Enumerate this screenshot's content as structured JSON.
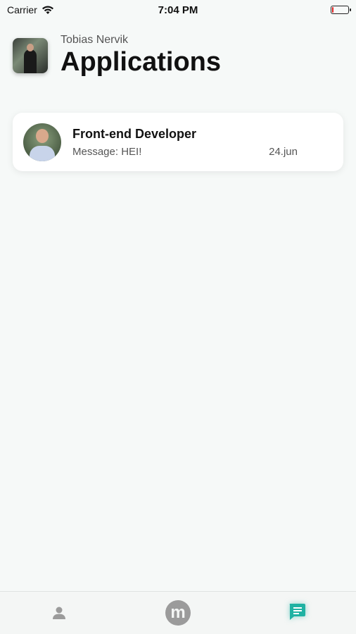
{
  "status_bar": {
    "carrier": "Carrier",
    "time": "7:04 PM",
    "battery_level": 0.08,
    "battery_color": "#e02020"
  },
  "header": {
    "subtitle": "Tobias Nervik",
    "title": "Applications"
  },
  "applications": [
    {
      "title": "Front-end Developer",
      "message": "Message: HEI!",
      "date": "24.jun"
    }
  ],
  "tab_bar": {
    "tabs": [
      {
        "icon": "profile-icon",
        "active": false
      },
      {
        "icon": "m-logo-icon",
        "label": "m",
        "active": false
      },
      {
        "icon": "chat-icon",
        "active": true
      }
    ],
    "active_color": "#1fb2a3",
    "inactive_color": "#9b9b9b"
  }
}
